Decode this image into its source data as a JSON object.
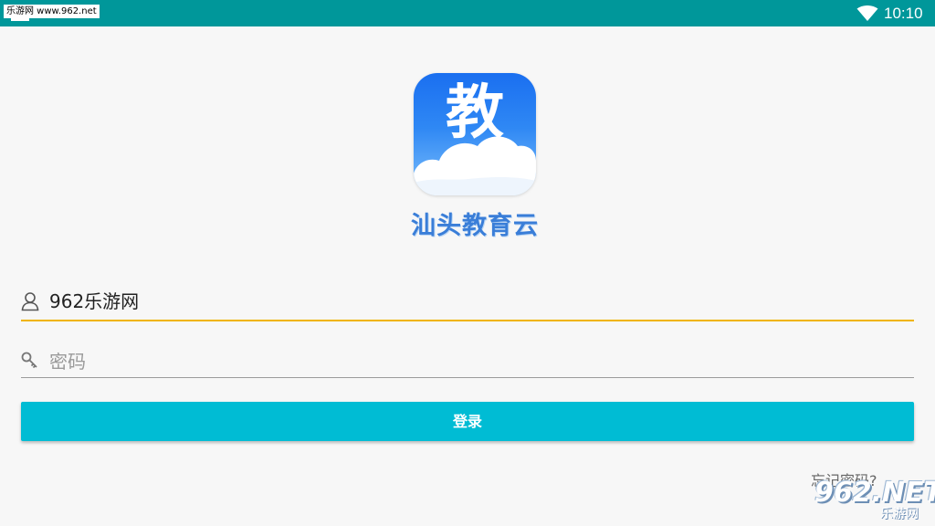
{
  "status_bar": {
    "badge_text": "乐游网 www.962.net",
    "time": "10:10"
  },
  "app": {
    "icon_char": "教",
    "name": "汕头教育云"
  },
  "form": {
    "username_value": "962乐游网",
    "password_placeholder": "密码",
    "login_label": "登录",
    "forgot_label": "忘记密码?"
  },
  "watermark": {
    "main": "962.NET",
    "sub": "乐游网"
  },
  "icons": {
    "wifi": "wifi-icon",
    "user": "user-icon",
    "key": "key-icon"
  },
  "colors": {
    "status_bar": "#00979a",
    "accent": "#00bcd4",
    "focus_underline": "#f0b400",
    "brand_blue": "#3a7ed8"
  }
}
